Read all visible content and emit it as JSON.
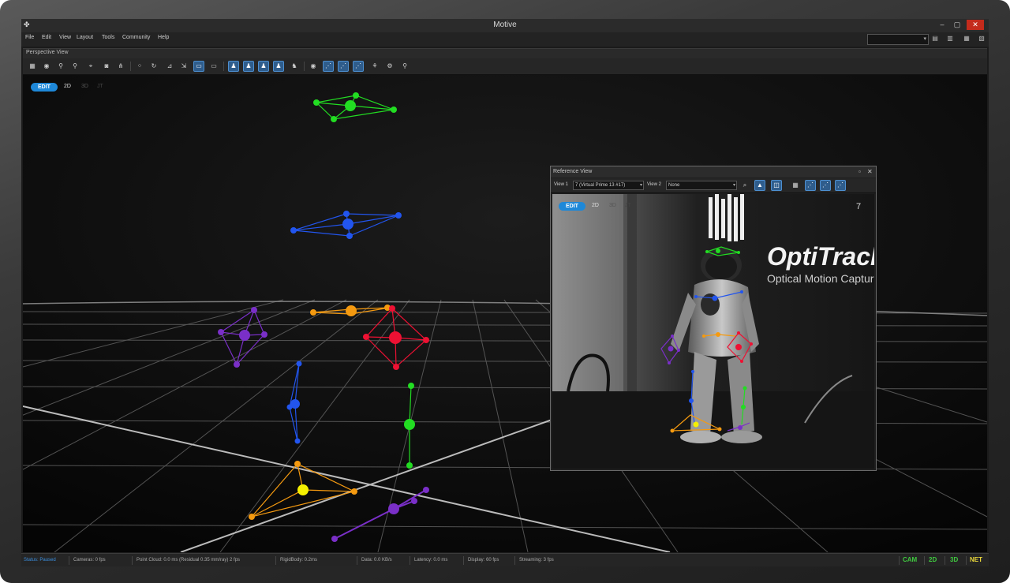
{
  "window": {
    "title": "Motive",
    "controls": {
      "minimize": "‒",
      "maximize": "▢",
      "close": "✕"
    }
  },
  "menu": {
    "items": [
      "File",
      "Edit",
      "View",
      "Layout",
      "Tools",
      "Community",
      "Help"
    ]
  },
  "perspective": {
    "title": "Perspective View",
    "modes": {
      "edit": "EDIT",
      "m2d": "2D",
      "m3d": "3D",
      "m4": "JT"
    }
  },
  "reference": {
    "title": "Reference View",
    "view1_label": "View 1",
    "view1_value": "7 (Virtual Prime 13 #17)",
    "view2_label": "View 2",
    "view2_value": "None",
    "modes": {
      "edit": "EDIT",
      "m2d": "2D",
      "m3d": "3D",
      "m4": "JT"
    },
    "camera_number": "7",
    "logo_text": "OptiTrack",
    "logo_sub": "Optical Motion Capture"
  },
  "status": {
    "status_label": "Status:",
    "status_value": "Paused",
    "cameras": "Cameras: 0 fps",
    "point_cloud": "Point Cloud: 0.0 ms (Residual 0.35 mm/ray) 2 fps",
    "rigidbody": "RigidBody: 0.2ms",
    "data": "Data: 0.0 KB/s",
    "latency": "Latency: 0.0 ms",
    "display": "Display: 60 fps",
    "streaming": "Streaming: 3 fps",
    "badges": {
      "cam": "CAM",
      "d2": "2D",
      "d3": "3D",
      "net": "NET"
    }
  },
  "colors": {
    "accent_blue": "#1e88d8",
    "marker_green": "#22dd22",
    "marker_blue": "#2255ee",
    "marker_orange": "#f59a10",
    "marker_red": "#ee1133",
    "marker_purple": "#7a2fc8",
    "marker_yellow": "#f5f000",
    "badge_green": "#3fc93f",
    "badge_yellow": "#e8d63a"
  },
  "icons": {
    "toolbar": [
      "grid-icon",
      "camera-rig-icon",
      "zoom-icon",
      "zoom-out-icon",
      "fit-icon",
      "snapshot-icon",
      "graph-icon",
      "markers-icon",
      "rotate-icon",
      "measure-icon",
      "select-icon",
      "view-a-icon",
      "view-b-icon",
      "view-c-icon",
      "view-d-icon",
      "view-e-icon",
      "view-f-icon",
      "view-g-icon",
      "view-h-icon",
      "eye-icon",
      "filter-a-icon",
      "filter-b-icon",
      "filter-c-icon",
      "skeleton-icon",
      "settings-icon",
      "pin-icon"
    ]
  }
}
